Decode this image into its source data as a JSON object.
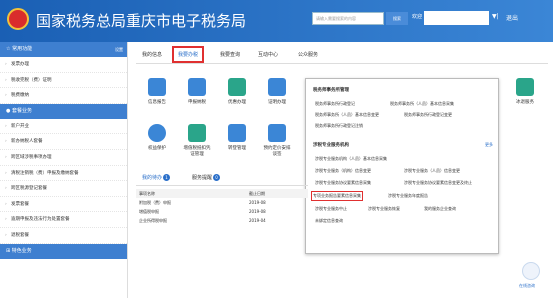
{
  "header": {
    "title": "国家税务总局重庆市电子税务局",
    "search_placeholder": "请输入需要搜索的内容",
    "search_btn": "搜索",
    "welcome": "欢迎",
    "arrow": "▼|",
    "logout": "退出"
  },
  "sidebar": {
    "sections": [
      {
        "title": "常用功能",
        "right": "设置",
        "items": [
          "发票办理",
          "税收完税（费）证明",
          "税费缴纳"
        ]
      },
      {
        "title": "套餐业务",
        "items": [
          "新户开业",
          "新办纳税人套餐",
          "跨区域涉税事项办理",
          "清税注销税（费）申报及缴纳套餐",
          "跨区税源登记套餐",
          "发票套餐",
          "逾期申报及违法行为处置套餐",
          "退税套餐"
        ]
      },
      {
        "title": "特色业务",
        "items": []
      }
    ]
  },
  "tabs": [
    "我的信息",
    "我要办税",
    "我要查询",
    "互动中心",
    "公众服务"
  ],
  "icons": [
    {
      "label": "信息报告",
      "color": "#3b86d6"
    },
    {
      "label": "申报纳税",
      "color": "#3b86d6"
    },
    {
      "label": "优惠办理",
      "color": "#2aa58a"
    },
    {
      "label": "证明办理",
      "color": "#3b86d6"
    },
    {
      "label": "权益保护",
      "color": "#3b86d6"
    },
    {
      "label": "增值税抵扣凭证管理",
      "color": "#2aa58a"
    },
    {
      "label": "转登管理",
      "color": "#3b86d6"
    },
    {
      "label": "预约定价安排谈签",
      "color": "#3b86d6"
    }
  ],
  "icon_right": "冰退服务",
  "popup": {
    "h1": "税务师事务所管理",
    "r1": [
      "税务师事务所行政登记",
      "税务师事务所（人员）基本信息采集"
    ],
    "r2": [
      "税务师事务所（人员）基本信息变更",
      "税务师事务所行政登记变更"
    ],
    "r3": [
      "税务师事务所行政登记注销"
    ],
    "h2": "涉税专业服务机构",
    "more": "更多",
    "r4": [
      "涉税专业服务机构（人员）基本信息采集"
    ],
    "r5": [
      "涉税专业服务（机构）信息变更",
      "涉税专业服务（人员）信息变更"
    ],
    "r6": [
      "涉税专业服务协议要素信息采集",
      "涉税专业服务协议要素信息变更及终止"
    ],
    "r7": [
      "专项业务报告要素信息采集",
      "涉税专业服务年度报告"
    ],
    "r8": [
      "涉税专业服务中止",
      "涉税专业服务恢复",
      "我的服务企业查询"
    ],
    "r9": [
      "未绑定信息查询"
    ]
  },
  "lower": {
    "tab1": "我的待办",
    "badge1": "1",
    "tab2": "服务提醒",
    "badge2": "0",
    "headers": [
      "事项名称",
      "截止日期"
    ],
    "rows": [
      [
        "附加税（费）申报",
        "2019-08"
      ],
      [
        "增值税申报",
        "2019-08"
      ],
      [
        "企业所得税申报",
        "2019-04"
      ]
    ]
  },
  "robot_label": "在线咨询"
}
